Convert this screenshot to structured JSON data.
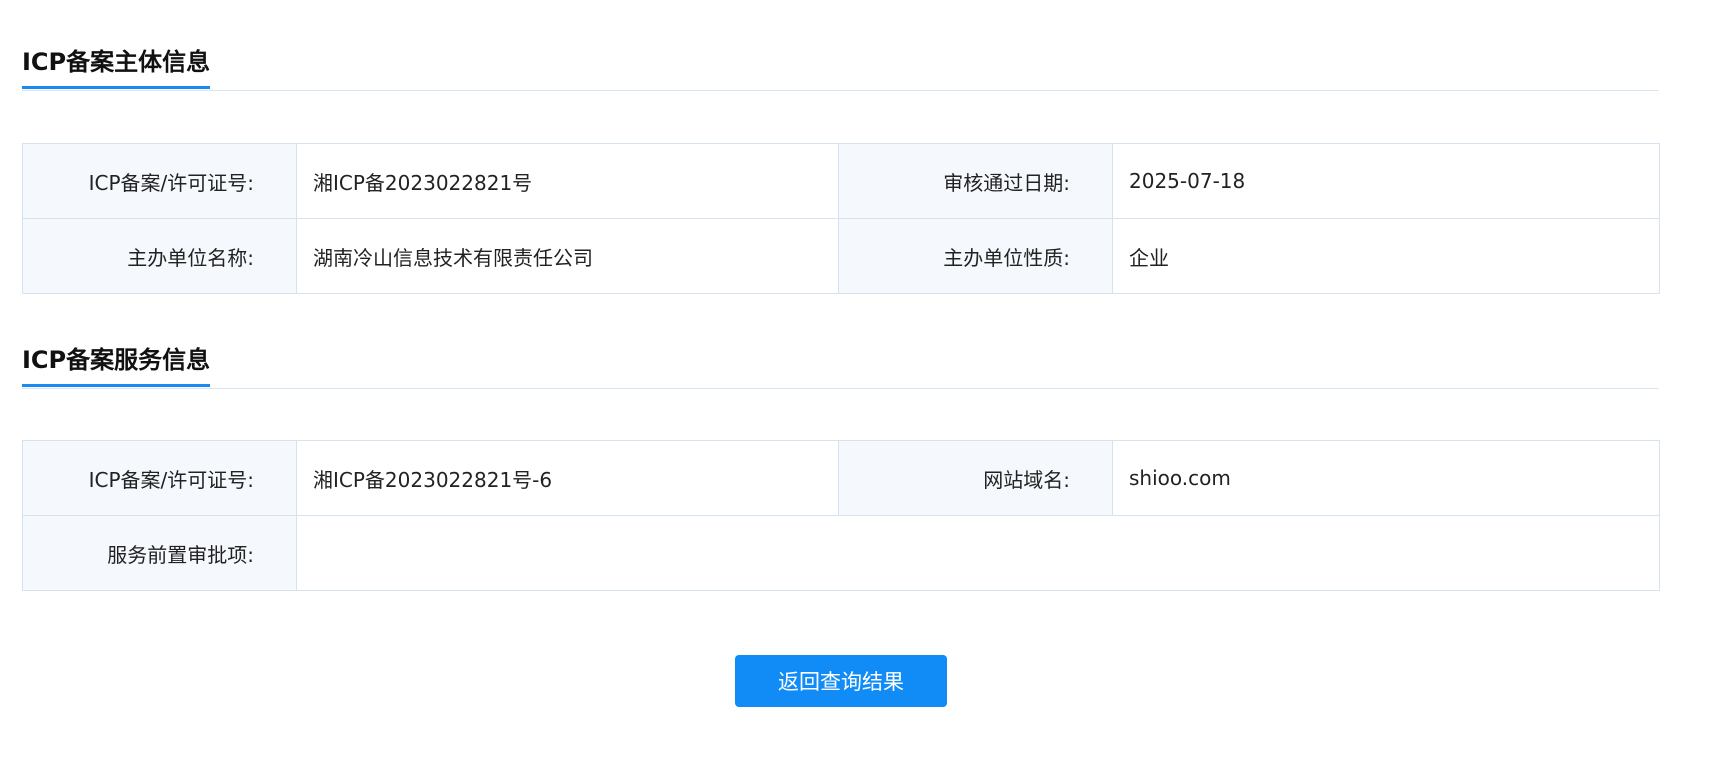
{
  "subject_section": {
    "title": "ICP备案主体信息",
    "rows": [
      {
        "label1": "ICP备案/许可证号:",
        "value1": "湘ICP备2023022821号",
        "label2": "审核通过日期:",
        "value2": "2025-07-18"
      },
      {
        "label1": "主办单位名称:",
        "value1": "湖南冷山信息技术有限责任公司",
        "label2": "主办单位性质:",
        "value2": "企业"
      }
    ]
  },
  "service_section": {
    "title": "ICP备案服务信息",
    "rows": [
      {
        "label1": "ICP备案/许可证号:",
        "value1": "湘ICP备2023022821号-6",
        "label2": "网站域名:",
        "value2": "shioo.com"
      }
    ],
    "approval": {
      "label": "服务前置审批项:",
      "value": ""
    }
  },
  "return_button": {
    "label": "返回查询结果"
  },
  "colors": {
    "accent": "#1a8cf0",
    "button": "#118cf7",
    "label_bg": "#f5f9fd",
    "border": "#d6e3ef"
  }
}
